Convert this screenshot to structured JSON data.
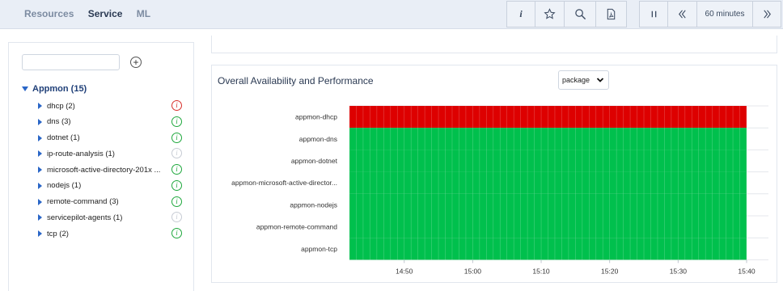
{
  "header": {
    "tabs": [
      "Resources",
      "Service",
      "ML"
    ],
    "active_tab": "Service",
    "info_label": "i",
    "time_range": "60 minutes"
  },
  "sidebar": {
    "search": {
      "value": "",
      "placeholder": ""
    },
    "root": {
      "label": "Appmon (15)"
    },
    "items": [
      {
        "label": "dhcp (2)",
        "status": "error"
      },
      {
        "label": "dns (3)",
        "status": "ok"
      },
      {
        "label": "dotnet (1)",
        "status": "ok"
      },
      {
        "label": "ip-route-analysis (1)",
        "status": "unknown"
      },
      {
        "label": "microsoft-active-directory-201x ...",
        "status": "ok"
      },
      {
        "label": "nodejs (1)",
        "status": "ok"
      },
      {
        "label": "remote-command (3)",
        "status": "ok"
      },
      {
        "label": "servicepilot-agents (1)",
        "status": "unknown"
      },
      {
        "label": "tcp (2)",
        "status": "ok"
      }
    ]
  },
  "panel": {
    "title": "Overall Availability and Performance",
    "group_select": "package"
  },
  "colors": {
    "error": "#dd0000",
    "ok": "#00c04d",
    "unknown": "#c7ccd4"
  },
  "chart_data": {
    "type": "heatmap",
    "rows": [
      {
        "name": "appmon-dhcp",
        "status": "error"
      },
      {
        "name": "appmon-dns",
        "status": "ok"
      },
      {
        "name": "appmon-dotnet",
        "status": "ok"
      },
      {
        "name": "appmon-microsoft-active-director...",
        "status": "ok"
      },
      {
        "name": "appmon-nodejs",
        "status": "ok"
      },
      {
        "name": "appmon-remote-command",
        "status": "ok"
      },
      {
        "name": "appmon-tcp",
        "status": "ok"
      }
    ],
    "x_ticks": [
      "14:50",
      "15:00",
      "15:10",
      "15:20",
      "15:30",
      "15:40"
    ],
    "x_range": [
      "14:42",
      "15:40"
    ],
    "cells_per_row": 58,
    "grid": true
  }
}
